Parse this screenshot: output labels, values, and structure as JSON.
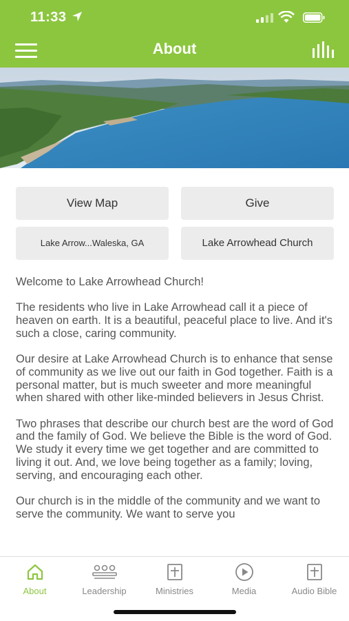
{
  "status_bar": {
    "time": "11:33"
  },
  "header": {
    "title": "About",
    "menu_icon": "hamburger-icon",
    "stats_icon": "bar-chart-icon"
  },
  "hero": {
    "image": "lake-aerial-photo"
  },
  "buttons": {
    "view_map": "View Map",
    "give": "Give",
    "address": "Lake Arrow...Waleska, GA",
    "church_name": "Lake Arrowhead Church"
  },
  "content": {
    "paragraphs": [
      "Welcome to Lake Arrowhead Church!",
      "The residents who live in Lake Arrowhead call it a piece of heaven on earth. It is a beautiful, peaceful place to live. And it's such a close, caring community.",
      "Our desire at Lake Arrowhead Church is to enhance that sense of community as we live out our faith in God together. Faith is a personal matter, but is much sweeter and more meaningful when shared with other like-minded believers in Jesus Christ.",
      "Two phrases that describe our church best are the word of God and the family of God. We believe the Bible is the word of God. We study it every time we get together and are committed to living it out. And, we love being together as a family; loving, serving, and encouraging each other.",
      "Our church is in the middle of the community and we want to serve the community. We want to serve you"
    ]
  },
  "tabs": [
    {
      "label": "About",
      "icon": "home-icon",
      "active": true
    },
    {
      "label": "Leadership",
      "icon": "people-icon",
      "active": false
    },
    {
      "label": "Ministries",
      "icon": "plus-square-icon",
      "active": false
    },
    {
      "label": "Media",
      "icon": "play-circle-icon",
      "active": false
    },
    {
      "label": "Audio Bible",
      "icon": "plus-square-icon",
      "active": false
    }
  ],
  "colors": {
    "accent": "#8cc63f",
    "button_bg": "#ececec",
    "text": "#555555"
  }
}
